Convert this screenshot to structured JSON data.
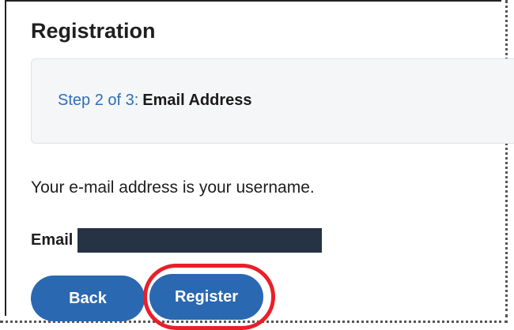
{
  "page": {
    "title": "Registration"
  },
  "step": {
    "progress": "Step 2 of 3:",
    "name": "Email Address"
  },
  "info": {
    "text": "Your e-mail address is your username."
  },
  "email": {
    "label": "Email",
    "value": ""
  },
  "buttons": {
    "back_label": "Back",
    "register_label": "Register"
  },
  "colors": {
    "accent": "#2a69b2",
    "step_link": "#2c6fbb",
    "highlight": "#e8202a",
    "redacted": "#263345"
  }
}
